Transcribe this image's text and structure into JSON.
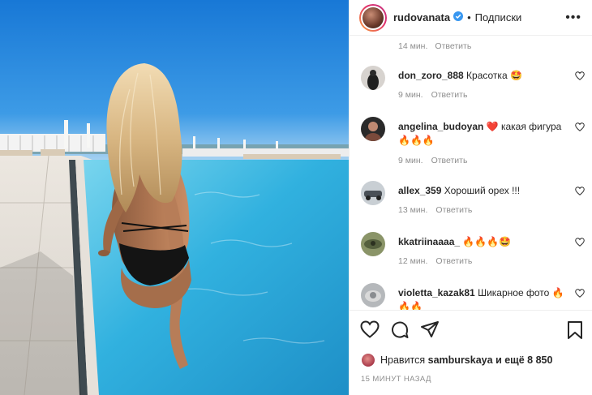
{
  "post": {
    "author": "rudovanata",
    "follow_label": "Подписки",
    "separator": "•",
    "more_label": "•••"
  },
  "comments_head": {
    "time": "14 мин.",
    "reply": "Ответить"
  },
  "comments": [
    {
      "user": "don_zoro_888",
      "text": "Красотка 🤩",
      "time": "9 мин.",
      "reply": "Ответить"
    },
    {
      "user": "angelina_budoyan",
      "text": "❤️ какая фигура 🔥🔥🔥",
      "time": "9 мин.",
      "reply": "Ответить"
    },
    {
      "user": "allex_359",
      "text": "Хороший орех !!!",
      "time": "13 мин.",
      "reply": "Ответить"
    },
    {
      "user": "kkatriinaaaa_",
      "text": "🔥🔥🔥🤩",
      "time": "12 мин.",
      "reply": "Ответить"
    },
    {
      "user": "violetta_kazak81",
      "text": "Шикарное фото 🔥🔥🔥",
      "time": "",
      "reply": ""
    }
  ],
  "likes": {
    "prefix": "Нравится",
    "user": "samburskaya",
    "suffix": "и ещё 8 850"
  },
  "timestamp": "15 МИНУТ НАЗАД",
  "icons": {
    "verified": "verified-badge-icon",
    "like": "heart-outline-icon",
    "comment": "speech-bubble-icon",
    "share": "paper-plane-icon",
    "save": "bookmark-icon"
  },
  "colors": {
    "verified_blue": "#3897f0",
    "meta_gray": "#8e8e8e",
    "text": "#262626",
    "sky": "#1f7fd6",
    "pool": "#3fb6df"
  }
}
